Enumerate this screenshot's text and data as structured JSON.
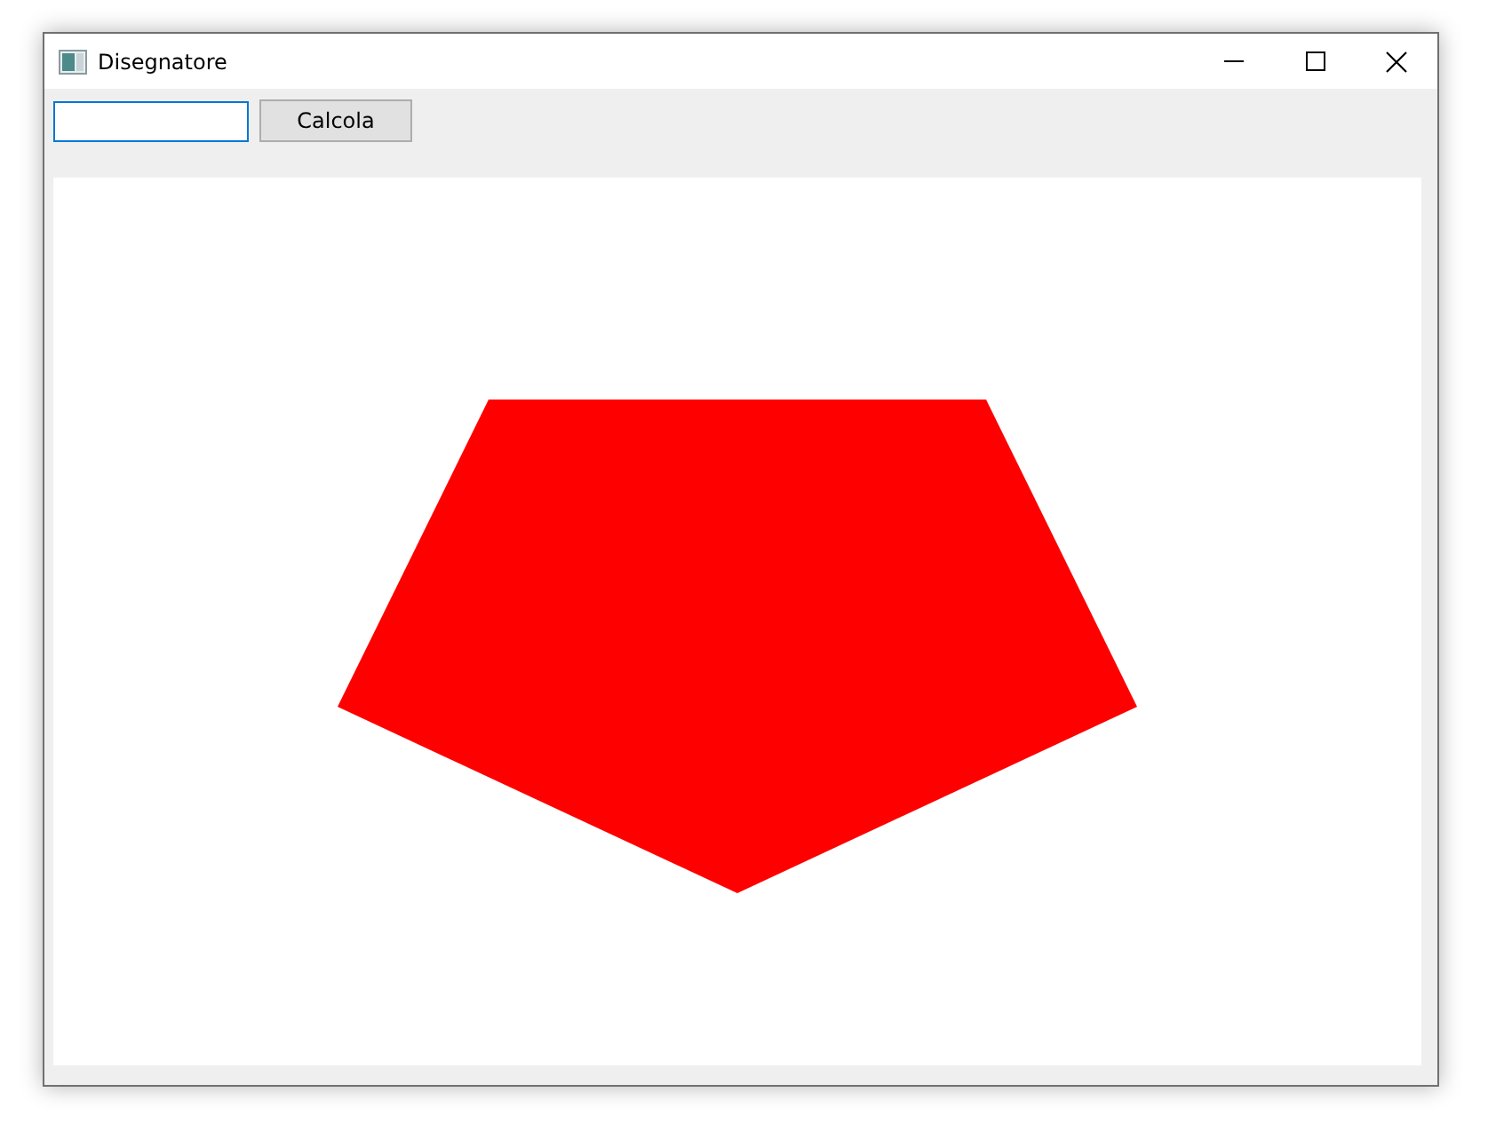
{
  "window": {
    "title": "Disegnatore"
  },
  "toolbar": {
    "button": "Calcola"
  }
}
